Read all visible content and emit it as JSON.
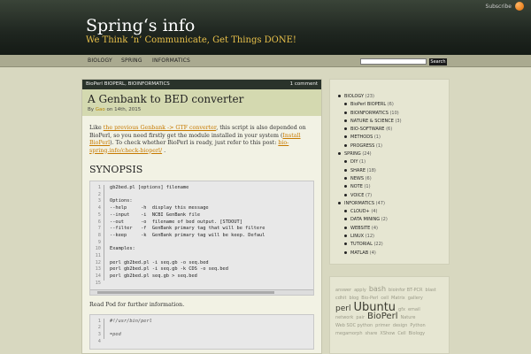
{
  "header": {
    "subscribe": "Subscribe",
    "site_title": "Spring‘s info",
    "tagline": "We Think ‘n’ Communicate, Get Things DONE!",
    "rss_icon": "rss-icon"
  },
  "nav": {
    "items": [
      "BIOLOGY",
      "SPRING",
      "INFORMATICS"
    ],
    "search_button": "Search"
  },
  "post": {
    "categories": "BioPerl BIOPERL,   BIOINFORMATICS",
    "comment_count": "1 comment",
    "title": "A Genbank to BED converter",
    "meta_by": "By",
    "author": "Gao",
    "meta_on": "on",
    "date": "14th, 2015",
    "intro_1": "Like ",
    "intro_link1": "the previous Genbank -> GTF converter",
    "intro_2": ", this script is also depended on BioPerl, so you need firstly get the module installed in your system (",
    "intro_link2": "Install BioPerl",
    "intro_3": "). To check whether BioPerl is ready, just refer to this post: ",
    "intro_link3": "bio-spring.info/check-bioperl/",
    "intro_4": " .",
    "synopsis": "SYNOPSIS",
    "code1_lines": [
      "1",
      "2",
      "3",
      "4",
      "5",
      "6",
      "7",
      "8",
      "9",
      "10",
      "11",
      "12",
      "13",
      "14",
      "15"
    ],
    "code1_text": "gb2bed.pl [options] filename\n\nOptions:\n--help     -h  display this message\n--input    -i  NCBI GenBank file\n--out      -o  filename of bed output. [STDOUT]\n--filter   -f  GenBank primary tag that will be filtere\n--keep     -k  GenBank primary tag will be keep. Defaul\n\nExamples:\n\nperl gb2bed.pl -i seq.gb -o seq.bed\nperl gb2bed.pl -i seq.gb -k CDS -o seq.bed\nperl gb2bed.pl seq.gb > seq.bed\n",
    "after_code": "Read Pod for further information.",
    "code2_lines": [
      "1",
      "2",
      "3",
      "4"
    ],
    "code2_text": "#!/usr/bin/perl\n\n=pod\n"
  },
  "categories": [
    {
      "label": "BIOLOGY",
      "count": "(23)",
      "level": 0
    },
    {
      "label": "BioPerl BIOPERL",
      "count": "(6)",
      "level": 1
    },
    {
      "label": "BIOINFORMATICS",
      "count": "(10)",
      "level": 1
    },
    {
      "label": "NATURE & SCIENCE",
      "count": "(3)",
      "level": 1
    },
    {
      "label": "BIO-SOFTWARE",
      "count": "(6)",
      "level": 1
    },
    {
      "label": "METHODS",
      "count": "(1)",
      "level": 1
    },
    {
      "label": "PROGRESS",
      "count": "(1)",
      "level": 1
    },
    {
      "label": "SPRING",
      "count": "(24)",
      "level": 0
    },
    {
      "label": "DIY",
      "count": "(1)",
      "level": 1
    },
    {
      "label": "SHARE",
      "count": "(18)",
      "level": 1
    },
    {
      "label": "NEWS",
      "count": "(6)",
      "level": 1
    },
    {
      "label": "NOTE",
      "count": "(1)",
      "level": 1
    },
    {
      "label": "VOICE",
      "count": "(7)",
      "level": 1
    },
    {
      "label": "INFORMATICS",
      "count": "(47)",
      "level": 0
    },
    {
      "label": "CLOUD+",
      "count": "(4)",
      "level": 1
    },
    {
      "label": "DATA MINING",
      "count": "(2)",
      "level": 1
    },
    {
      "label": "WEBSITE",
      "count": "(4)",
      "level": 1
    },
    {
      "label": "LINUX",
      "count": "(12)",
      "level": 1
    },
    {
      "label": "TUTORIAL",
      "count": "(22)",
      "level": 1
    },
    {
      "label": "MATLAB",
      "count": "(4)",
      "level": 1
    }
  ],
  "tags": [
    {
      "text": "answer",
      "size": 5
    },
    {
      "text": "apply",
      "size": 5
    },
    {
      "text": "bash",
      "size": 8
    },
    {
      "text": "bioinfor BT-PCR",
      "size": 5
    },
    {
      "text": "blast",
      "size": 5
    },
    {
      "text": "cdhit",
      "size": 5
    },
    {
      "text": "blog",
      "size": 5
    },
    {
      "text": "Bio-Perl",
      "size": 5
    },
    {
      "text": "cell",
      "size": 5
    },
    {
      "text": "Matrix",
      "size": 5
    },
    {
      "text": "gallery",
      "size": 5
    },
    {
      "text": "perl",
      "size": 9
    },
    {
      "text": "Ubuntu",
      "size": 13
    },
    {
      "text": "gfx",
      "size": 5
    },
    {
      "text": "email",
      "size": 5
    },
    {
      "text": "network",
      "size": 5
    },
    {
      "text": "pair",
      "size": 5
    },
    {
      "text": "BioPerl",
      "size": 10
    },
    {
      "text": "Nature",
      "size": 5
    },
    {
      "text": "Web SOC python",
      "size": 5
    },
    {
      "text": "primer",
      "size": 5
    },
    {
      "text": "design",
      "size": 5
    },
    {
      "text": "Python",
      "size": 5
    },
    {
      "text": "megamorph",
      "size": 5
    },
    {
      "text": "share",
      "size": 5
    },
    {
      "text": "XShow",
      "size": 5
    },
    {
      "text": "Cell",
      "size": 5
    },
    {
      "text": "Biology",
      "size": 5
    }
  ],
  "colors": {
    "accent": "#e8c04a",
    "link": "#c77a00",
    "header_bg": "#1f2620"
  }
}
